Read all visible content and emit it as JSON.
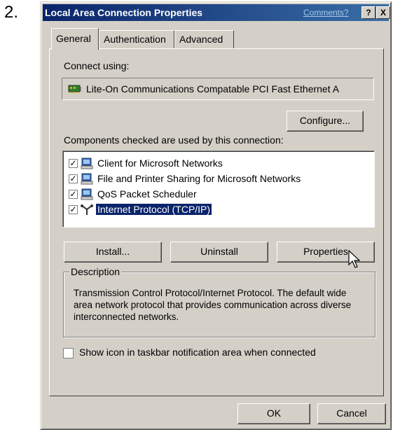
{
  "step_number": "2.",
  "window": {
    "title": "Local Area Connection Properties",
    "comments_link": "Comments?",
    "help_button": "?",
    "close_button": "X"
  },
  "tabs": [
    {
      "label": "General",
      "active": true
    },
    {
      "label": "Authentication",
      "active": false
    },
    {
      "label": "Advanced",
      "active": false
    }
  ],
  "connect_using_label": "Connect using:",
  "adapter": {
    "icon": "network-card-icon",
    "name": "Lite-On Communications Compatable PCI Fast Ethernet A"
  },
  "configure_button": "Configure...",
  "components_label": "Components checked are used by this connection:",
  "components": [
    {
      "label": "Client for Microsoft Networks",
      "checked": true,
      "icon": "computer-icon",
      "selected": false
    },
    {
      "label": "File and Printer Sharing for Microsoft Networks",
      "checked": true,
      "icon": "computer-icon",
      "selected": false
    },
    {
      "label": "QoS Packet Scheduler",
      "checked": true,
      "icon": "computer-icon",
      "selected": false
    },
    {
      "label": "Internet Protocol (TCP/IP)",
      "checked": true,
      "icon": "protocol-icon",
      "selected": true
    }
  ],
  "buttons": {
    "install": "Install...",
    "uninstall": "Uninstall",
    "properties": "Properties"
  },
  "description": {
    "legend": "Description",
    "text": "Transmission Control Protocol/Internet Protocol. The default wide area network protocol that provides communication across diverse interconnected networks."
  },
  "show_icon": {
    "label": "Show icon in taskbar notification area when connected",
    "checked": false
  },
  "footer": {
    "ok": "OK",
    "cancel": "Cancel"
  },
  "colors": {
    "titlebar_start": "#0a246a",
    "titlebar_end": "#3a6ea5",
    "dialog_face": "#d4d0c8",
    "selection": "#0a246a"
  }
}
